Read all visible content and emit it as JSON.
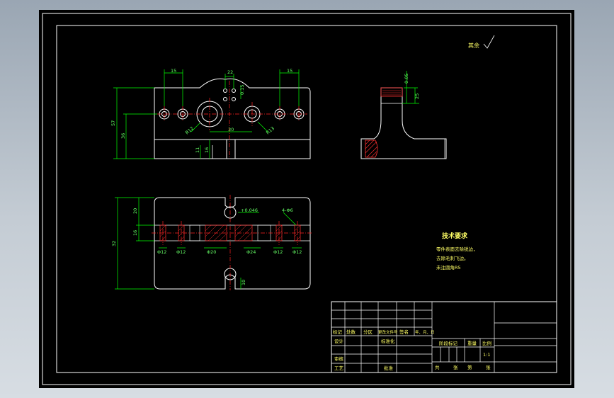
{
  "surface_finish": {
    "text": "其余"
  },
  "tech_requirements": {
    "title": "技术要求",
    "lines": [
      "零件表面去除锐边，",
      "去除毛刺飞边。",
      "未注圆角R5"
    ]
  },
  "title_block": {
    "header_labels": [
      "标记",
      "处数",
      "分区",
      "更改文件号",
      "签名",
      "年、月、日"
    ],
    "designer": "设计",
    "standardization": "标准化",
    "checker": "审核",
    "process": "工艺",
    "approve": "批准",
    "stage_mark": "阶段标记",
    "weight": "重量",
    "scale": "比例",
    "scale_value": "1:1",
    "sheets_total": "共",
    "sheets_total_unit": "张",
    "sheet_no": "第",
    "sheet_no_unit": "张"
  },
  "dimensions": {
    "front_top_left": "15",
    "front_top_right": "15",
    "front_top_mid": "22",
    "front_height": "57",
    "front_height_inner": "36",
    "front_r12": "R12",
    "front_r13": "R13",
    "front_h1": "11",
    "front_h2": "16",
    "front_span": "30",
    "front_tol": "0.15",
    "side_top": "0.05",
    "side_h": "25",
    "plan_height": "32",
    "plan_h1": "20",
    "plan_h2": "16",
    "plan_d12a": "Φ12",
    "plan_d12b": "Φ12",
    "plan_d20": "Φ20",
    "plan_d24": "Φ24",
    "plan_d12c": "Φ12",
    "plan_d12d": "Φ12",
    "plan_bottom": "10",
    "plan_tol": "+0.046",
    "plan_m": "4-Φ6"
  },
  "colors": {
    "drawing_bg": "#000000",
    "outline": "#ffffff",
    "dimension": "#00ff00",
    "centerline": "#ff2020",
    "hatch": "#ff3030",
    "text": "#ffff66"
  }
}
